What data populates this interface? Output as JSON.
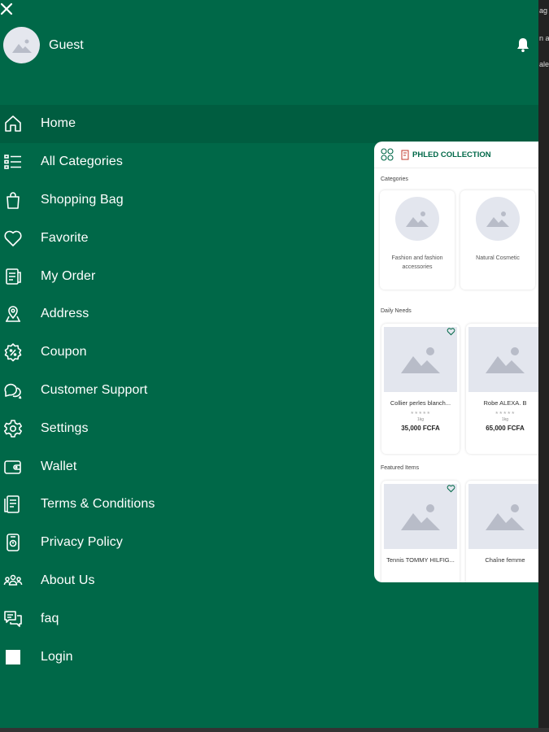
{
  "drawer": {
    "user_name": "Guest",
    "menu": [
      {
        "label": "Home",
        "icon": "home-icon",
        "active": true
      },
      {
        "label": "All Categories",
        "icon": "list-icon"
      },
      {
        "label": "Shopping Bag",
        "icon": "shopping-bag-icon"
      },
      {
        "label": "Favorite",
        "icon": "heart-icon"
      },
      {
        "label": "My Order",
        "icon": "order-icon"
      },
      {
        "label": "Address",
        "icon": "location-pin-icon"
      },
      {
        "label": "Coupon",
        "icon": "coupon-icon"
      },
      {
        "label": "Customer Support",
        "icon": "chat-icon"
      },
      {
        "label": "Settings",
        "icon": "gear-icon"
      },
      {
        "label": "Wallet",
        "icon": "wallet-icon"
      },
      {
        "label": "Terms & Conditions",
        "icon": "document-icon"
      },
      {
        "label": "Privacy Policy",
        "icon": "shield-icon"
      },
      {
        "label": "About Us",
        "icon": "people-icon"
      },
      {
        "label": "faq",
        "icon": "faq-icon"
      },
      {
        "label": "Login",
        "icon": "login-icon"
      }
    ]
  },
  "preview": {
    "brand": "PHLED COLLECTION",
    "categories_title": "Categories",
    "categories": [
      {
        "label": "Fashion and fashion accessories"
      },
      {
        "label": "Natural Cosmetic"
      }
    ],
    "daily_needs_title": "Daily Needs",
    "daily_needs": [
      {
        "name": "Collier perles blanch...",
        "unit": "1kg",
        "price": "35,000 FCFA"
      },
      {
        "name": "Robe ALEXA. B",
        "unit": "1kg",
        "price": "65,000 FCFA"
      }
    ],
    "featured_title": "Featured Items",
    "featured": [
      {
        "name": "Tennis TOMMY HILFIG..."
      },
      {
        "name": "Chaîne femme"
      }
    ]
  },
  "colors": {
    "drawer_bg": "#006848",
    "active_item_bg": "#005d40",
    "brand": "#006848"
  }
}
